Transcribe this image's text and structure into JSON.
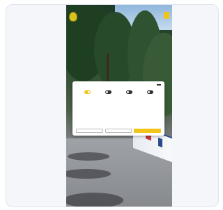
{
  "site": {
    "logo_text": "",
    "top_button_label": ""
  },
  "cookie_modal": {
    "title": "",
    "brand_tag": "",
    "body_text": "",
    "toggles": [
      {
        "label": "",
        "on": true
      },
      {
        "label": "",
        "on": false
      },
      {
        "label": "",
        "on": false
      },
      {
        "label": "",
        "on": false
      }
    ],
    "details_link": "",
    "buttons": {
      "necessary": "",
      "selection": "",
      "accept_all": ""
    }
  },
  "colors": {
    "accent": "#f2c419",
    "card_bg": "#f4f6fa"
  }
}
